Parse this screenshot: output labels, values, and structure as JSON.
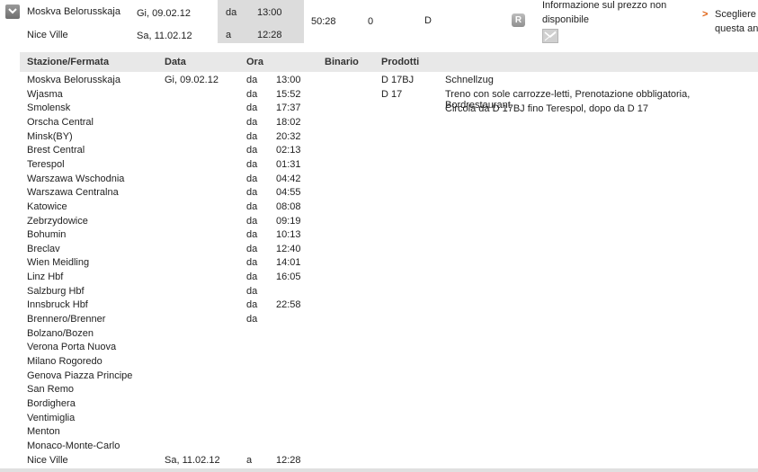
{
  "summary": {
    "from_station": "Moskva Belorusskaja",
    "from_date": "Gi, 09.02.12",
    "from_dir": "da",
    "from_time": "13:00",
    "to_station": "Nice Ville",
    "to_date": "Sa, 11.02.12",
    "to_dir": "a",
    "to_time": "12:28",
    "duration": "50:28",
    "changes": "0",
    "product": "D",
    "price_info_line1": "Informazione sul prezzo non",
    "price_info_line2": "disponibile",
    "choose_line1": "Scegliere",
    "choose_line2": "questa an",
    "r_badge": "R",
    "icons": [
      "collapse-chevron-icon",
      "reservation-r-icon",
      "mail-icon",
      "arrow-right-icon"
    ]
  },
  "table": {
    "headers": {
      "station": "Stazione/Fermata",
      "date": "Data",
      "time": "Ora",
      "platform": "Binario",
      "products": "Prodotti"
    },
    "products": [
      {
        "code": "D 17BJ",
        "desc": "Schnellzug"
      },
      {
        "code": "D 17",
        "desc": "Treno con sole carrozze-letti, Prenotazione obbligatoria, Bordrestaurant"
      },
      {
        "code": "",
        "desc": "Circola da D 17BJ fino Terespol, dopo da D 17"
      }
    ],
    "rows": [
      {
        "station": "Moskva Belorusskaja",
        "date": "Gi, 09.02.12",
        "dir": "da",
        "time": "13:00"
      },
      {
        "station": "Wjasma",
        "date": "",
        "dir": "da",
        "time": "15:52"
      },
      {
        "station": "Smolensk",
        "date": "",
        "dir": "da",
        "time": "17:37"
      },
      {
        "station": "Orscha Central",
        "date": "",
        "dir": "da",
        "time": "18:02"
      },
      {
        "station": "Minsk(BY)",
        "date": "",
        "dir": "da",
        "time": "20:32"
      },
      {
        "station": "Brest Central",
        "date": "",
        "dir": "da",
        "time": "02:13"
      },
      {
        "station": "Terespol",
        "date": "",
        "dir": "da",
        "time": "01:31"
      },
      {
        "station": "Warszawa Wschodnia",
        "date": "",
        "dir": "da",
        "time": "04:42"
      },
      {
        "station": "Warszawa Centralna",
        "date": "",
        "dir": "da",
        "time": "04:55"
      },
      {
        "station": "Katowice",
        "date": "",
        "dir": "da",
        "time": "08:08"
      },
      {
        "station": "Zebrzydowice",
        "date": "",
        "dir": "da",
        "time": "09:19"
      },
      {
        "station": "Bohumin",
        "date": "",
        "dir": "da",
        "time": "10:13"
      },
      {
        "station": "Breclav",
        "date": "",
        "dir": "da",
        "time": "12:40"
      },
      {
        "station": "Wien Meidling",
        "date": "",
        "dir": "da",
        "time": "14:01"
      },
      {
        "station": "Linz Hbf",
        "date": "",
        "dir": "da",
        "time": "16:05"
      },
      {
        "station": "Salzburg Hbf",
        "date": "",
        "dir": "da",
        "time": ""
      },
      {
        "station": "Innsbruck Hbf",
        "date": "",
        "dir": "da",
        "time": "22:58"
      },
      {
        "station": "Brennero/Brenner",
        "date": "",
        "dir": "da",
        "time": ""
      },
      {
        "station": "Bolzano/Bozen",
        "date": "",
        "dir": "",
        "time": ""
      },
      {
        "station": "Verona Porta Nuova",
        "date": "",
        "dir": "",
        "time": ""
      },
      {
        "station": "Milano Rogoredo",
        "date": "",
        "dir": "",
        "time": ""
      },
      {
        "station": "Genova Piazza Principe",
        "date": "",
        "dir": "",
        "time": ""
      },
      {
        "station": "San Remo",
        "date": "",
        "dir": "",
        "time": ""
      },
      {
        "station": "Bordighera",
        "date": "",
        "dir": "",
        "time": ""
      },
      {
        "station": "Ventimiglia",
        "date": "",
        "dir": "",
        "time": ""
      },
      {
        "station": "Menton",
        "date": "",
        "dir": "",
        "time": ""
      },
      {
        "station": "Monaco-Monte-Carlo",
        "date": "",
        "dir": "",
        "time": ""
      },
      {
        "station": "Nice Ville",
        "date": "Sa, 11.02.12",
        "dir": "a",
        "time": "12:28"
      }
    ]
  }
}
